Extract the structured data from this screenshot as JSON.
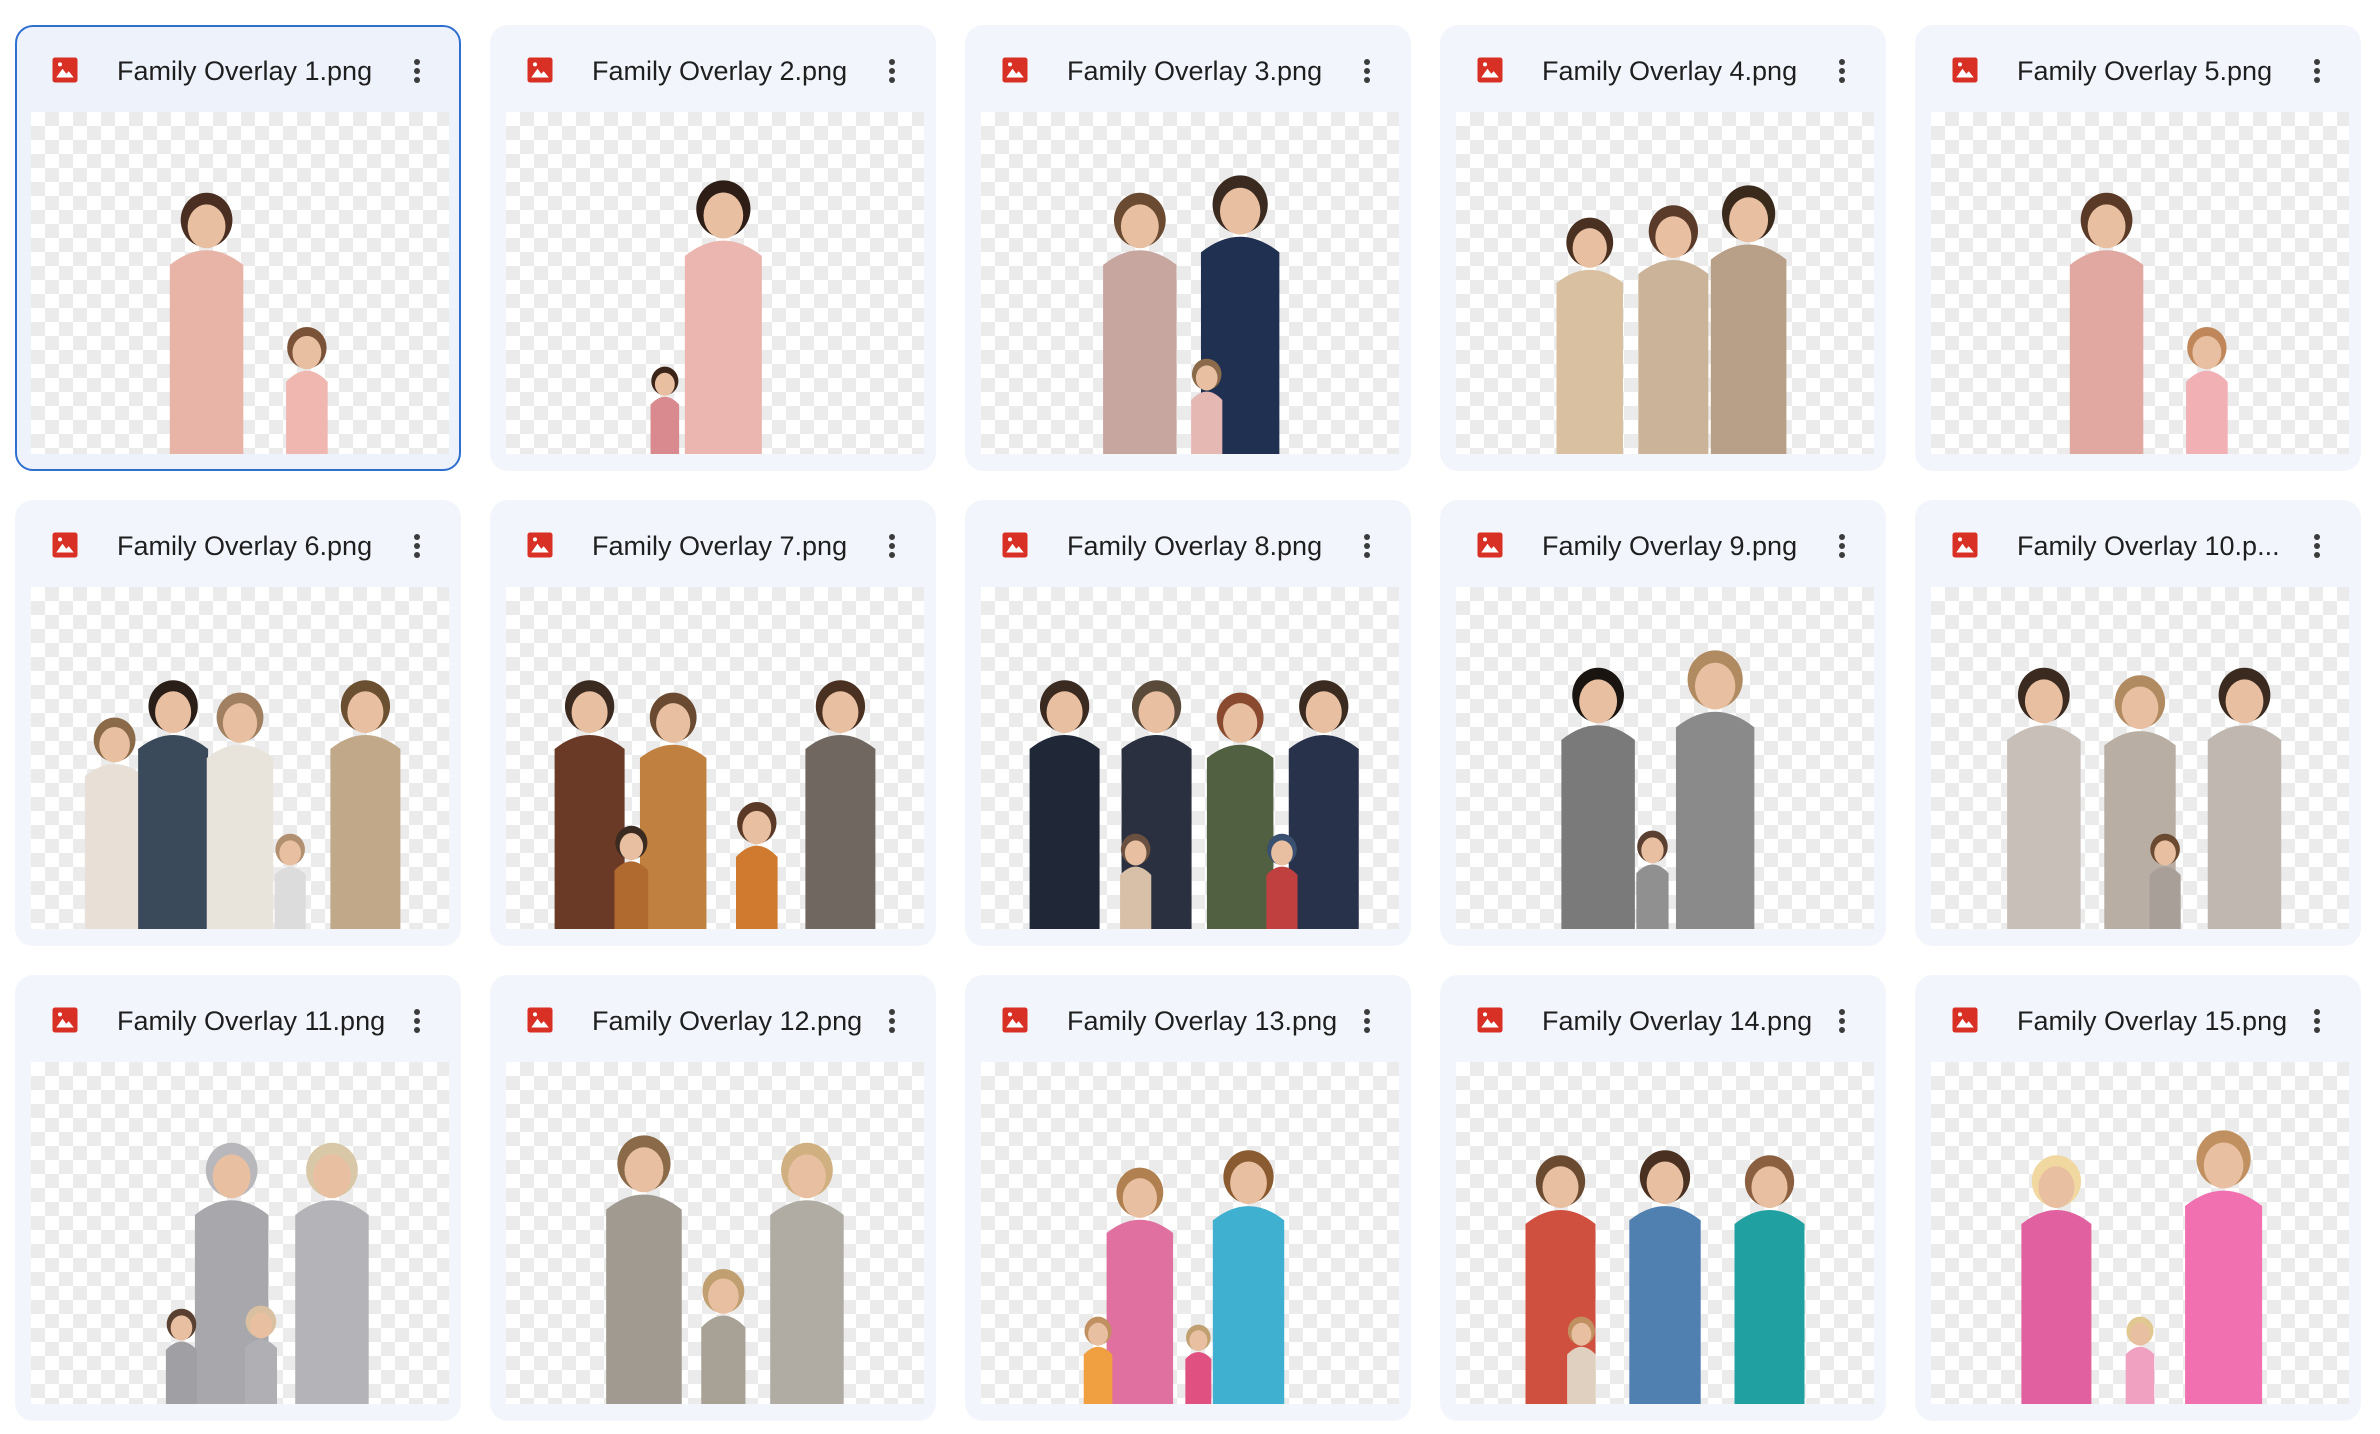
{
  "files": [
    {
      "name": "Family Overlay 1.png",
      "selected": true,
      "people": [
        {
          "c": "#e8b4a8",
          "h": "#4a2e22",
          "s": 1.05,
          "x": 0.42,
          "adult": true
        },
        {
          "c": "#f0b6b0",
          "h": "#7a5238",
          "s": 0.8,
          "x": 0.66,
          "adult": false
        }
      ]
    },
    {
      "name": "Family Overlay 2.png",
      "selected": false,
      "people": [
        {
          "c": "#ecb6b0",
          "h": "#2e1d16",
          "s": 1.1,
          "x": 0.52,
          "adult": true
        },
        {
          "c": "#d98a8e",
          "h": "#3b2418",
          "s": 0.55,
          "x": 0.38,
          "adult": false
        }
      ]
    },
    {
      "name": "Family Overlay 3.png",
      "selected": false,
      "people": [
        {
          "c": "#c7a6a0",
          "h": "#6a4a30",
          "s": 1.05,
          "x": 0.38,
          "adult": true
        },
        {
          "c": "#203050",
          "h": "#3a2a20",
          "s": 1.12,
          "x": 0.62,
          "adult": true
        },
        {
          "c": "#e6b8b4",
          "h": "#8a6a4a",
          "s": 0.6,
          "x": 0.54,
          "adult": false
        }
      ]
    },
    {
      "name": "Family Overlay 4.png",
      "selected": false,
      "people": [
        {
          "c": "#d8c0a0",
          "h": "#4a3020",
          "s": 0.95,
          "x": 0.32,
          "adult": true
        },
        {
          "c": "#cbb39a",
          "h": "#5a3a28",
          "s": 1.0,
          "x": 0.52,
          "adult": true
        },
        {
          "c": "#b8a088",
          "h": "#3a2a1c",
          "s": 1.08,
          "x": 0.7,
          "adult": true
        }
      ]
    },
    {
      "name": "Family Overlay 5.png",
      "selected": false,
      "people": [
        {
          "c": "#e0a8a0",
          "h": "#5a3a26",
          "s": 1.05,
          "x": 0.42,
          "adult": true
        },
        {
          "c": "#f0b0b4",
          "h": "#c0885a",
          "s": 0.8,
          "x": 0.66,
          "adult": false
        }
      ]
    },
    {
      "name": "Family Overlay 6.png",
      "selected": false,
      "people": [
        {
          "c": "#e8e0d6",
          "h": "#8a6a48",
          "s": 0.85,
          "x": 0.2,
          "adult": true
        },
        {
          "c": "#3a4a5a",
          "h": "#2a1e18",
          "s": 1.0,
          "x": 0.34,
          "adult": true
        },
        {
          "c": "#e8e4dc",
          "h": "#a08060",
          "s": 0.95,
          "x": 0.5,
          "adult": true
        },
        {
          "c": "#c0a888",
          "h": "#6a5030",
          "s": 1.0,
          "x": 0.8,
          "adult": true
        },
        {
          "c": "#dcdcdc",
          "h": "#b09070",
          "s": 0.6,
          "x": 0.62,
          "adult": false
        }
      ]
    },
    {
      "name": "Family Overlay 7.png",
      "selected": false,
      "people": [
        {
          "c": "#6a3a26",
          "h": "#3a2a20",
          "s": 1.0,
          "x": 0.2,
          "adult": true
        },
        {
          "c": "#c08040",
          "h": "#6a4a30",
          "s": 0.95,
          "x": 0.4,
          "adult": true
        },
        {
          "c": "#d07a30",
          "h": "#5a3a26",
          "s": 0.8,
          "x": 0.6,
          "adult": false
        },
        {
          "c": "#706860",
          "h": "#4a3020",
          "s": 1.0,
          "x": 0.8,
          "adult": true
        },
        {
          "c": "#b06a30",
          "h": "#3a2a20",
          "s": 0.65,
          "x": 0.3,
          "adult": false
        }
      ]
    },
    {
      "name": "Family Overlay 8.png",
      "selected": false,
      "people": [
        {
          "c": "#202838",
          "h": "#3a2a20",
          "s": 1.0,
          "x": 0.2,
          "adult": true
        },
        {
          "c": "#2a3040",
          "h": "#5a4a3a",
          "s": 1.0,
          "x": 0.42,
          "adult": true
        },
        {
          "c": "#506040",
          "h": "#8a4a30",
          "s": 0.95,
          "x": 0.62,
          "adult": true
        },
        {
          "c": "#28324a",
          "h": "#3a2a20",
          "s": 1.0,
          "x": 0.82,
          "adult": true
        },
        {
          "c": "#d8c0a8",
          "h": "#6a5040",
          "s": 0.6,
          "x": 0.37,
          "adult": false
        },
        {
          "c": "#c04040",
          "h": "#3a5070",
          "s": 0.6,
          "x": 0.72,
          "adult": false
        }
      ]
    },
    {
      "name": "Family Overlay 9.png",
      "selected": false,
      "people": [
        {
          "c": "#7a7a7a",
          "h": "#1a1410",
          "s": 1.05,
          "x": 0.34,
          "adult": true
        },
        {
          "c": "#8a8a8a",
          "h": "#b08a60",
          "s": 1.12,
          "x": 0.62,
          "adult": true
        },
        {
          "c": "#909090",
          "h": "#5a4030",
          "s": 0.62,
          "x": 0.47,
          "adult": false
        }
      ]
    },
    {
      "name": "Family Overlay 10.p...",
      "selected": false,
      "people": [
        {
          "c": "#c8c0b8",
          "h": "#3a2a20",
          "s": 1.05,
          "x": 0.27,
          "adult": true
        },
        {
          "c": "#b8aea4",
          "h": "#b08a60",
          "s": 1.02,
          "x": 0.5,
          "adult": true
        },
        {
          "c": "#c0b8b0",
          "h": "#3a2a20",
          "s": 1.05,
          "x": 0.75,
          "adult": true
        },
        {
          "c": "#a8a098",
          "h": "#6a4a30",
          "s": 0.6,
          "x": 0.56,
          "adult": false
        }
      ]
    },
    {
      "name": "Family Overlay 11.png",
      "selected": false,
      "people": [
        {
          "c": "#a8a8ac",
          "h": "#b8b8bc",
          "s": 1.05,
          "x": 0.48,
          "adult": true
        },
        {
          "c": "#b4b4b8",
          "h": "#d8c8a8",
          "s": 1.05,
          "x": 0.72,
          "adult": true
        },
        {
          "c": "#a0a0a4",
          "h": "#5a4030",
          "s": 0.6,
          "x": 0.36,
          "adult": false
        },
        {
          "c": "#b0b0b4",
          "h": "#d8c0a0",
          "s": 0.62,
          "x": 0.55,
          "adult": false
        }
      ]
    },
    {
      "name": "Family Overlay 12.png",
      "selected": false,
      "people": [
        {
          "c": "#a09a90",
          "h": "#8a6a48",
          "s": 1.08,
          "x": 0.33,
          "adult": true
        },
        {
          "c": "#a8a296",
          "h": "#c0a070",
          "s": 0.85,
          "x": 0.52,
          "adult": false
        },
        {
          "c": "#b0aca4",
          "h": "#d0b080",
          "s": 1.05,
          "x": 0.72,
          "adult": true
        }
      ]
    },
    {
      "name": "Family Overlay 13.png",
      "selected": false,
      "people": [
        {
          "c": "#e070a0",
          "h": "#b08050",
          "s": 0.95,
          "x": 0.38,
          "adult": true
        },
        {
          "c": "#40b0d0",
          "h": "#8a5a30",
          "s": 1.02,
          "x": 0.64,
          "adult": true
        },
        {
          "c": "#f0a040",
          "h": "#c09060",
          "s": 0.55,
          "x": 0.28,
          "adult": false
        },
        {
          "c": "#e05080",
          "h": "#c0a070",
          "s": 0.5,
          "x": 0.52,
          "adult": false
        }
      ]
    },
    {
      "name": "Family Overlay 14.png",
      "selected": false,
      "people": [
        {
          "c": "#d05040",
          "h": "#6a4a30",
          "s": 1.0,
          "x": 0.25,
          "adult": true
        },
        {
          "c": "#5080b0",
          "h": "#4a3020",
          "s": 1.02,
          "x": 0.5,
          "adult": true
        },
        {
          "c": "#20a0a0",
          "h": "#8a6040",
          "s": 1.0,
          "x": 0.75,
          "adult": true
        },
        {
          "c": "#e0d0c0",
          "h": "#c09060",
          "s": 0.55,
          "x": 0.3,
          "adult": false
        }
      ]
    },
    {
      "name": "Family Overlay 15.png",
      "selected": false,
      "people": [
        {
          "c": "#e060a0",
          "h": "#f0d8a0",
          "s": 1.0,
          "x": 0.3,
          "adult": true
        },
        {
          "c": "#f070b0",
          "h": "#c09060",
          "s": 1.1,
          "x": 0.7,
          "adult": true
        },
        {
          "c": "#f0a0c0",
          "h": "#e0c890",
          "s": 0.55,
          "x": 0.5,
          "adult": false
        }
      ]
    }
  ],
  "icons": {
    "file_type": "image-file-icon",
    "menu": "more-vertical-icon"
  },
  "colors": {
    "file_icon": "#d93025",
    "selected_border": "#2f6fd0",
    "card_bg": "#f2f6fc",
    "skin": "#e8bfa0"
  }
}
